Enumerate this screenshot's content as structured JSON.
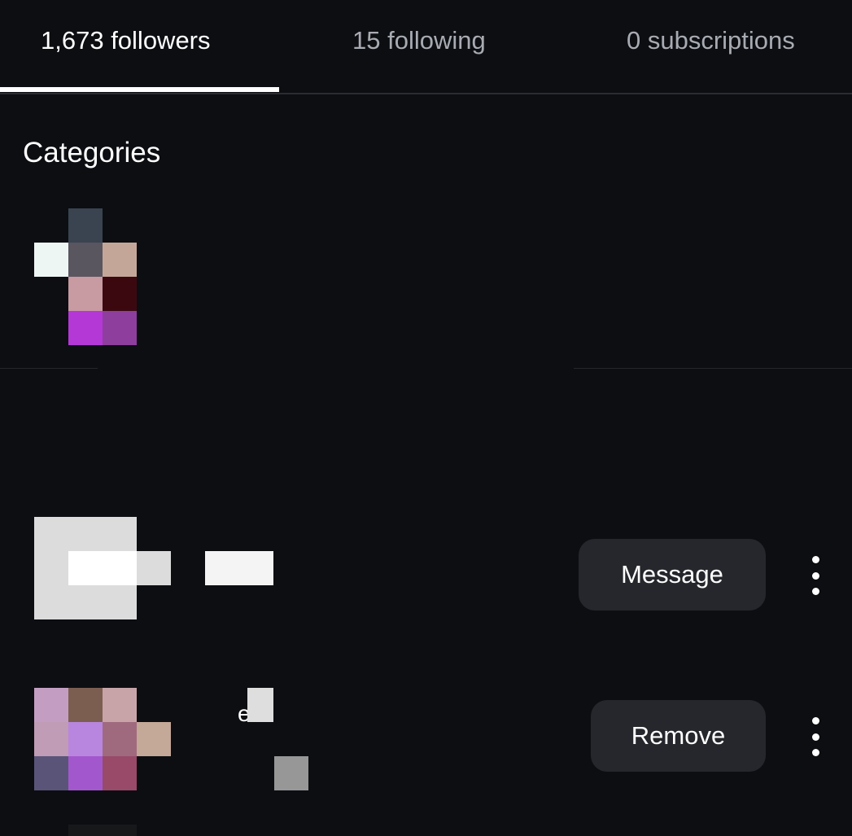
{
  "tabs": {
    "followers": "1,673 followers",
    "following": "15 following",
    "subscriptions": "0 subscriptions"
  },
  "section": {
    "title": "Categories"
  },
  "rows": [
    {
      "button_label": "Message"
    },
    {
      "button_label": "Remove",
      "name_fragment": "e"
    }
  ],
  "colors": {
    "background": "#0c0e12",
    "button_bg": "#25272c",
    "active_tab": "#ffffff",
    "inactive_tab": "#a8abb2"
  },
  "icons": {
    "more": "more-vertical-icon"
  }
}
